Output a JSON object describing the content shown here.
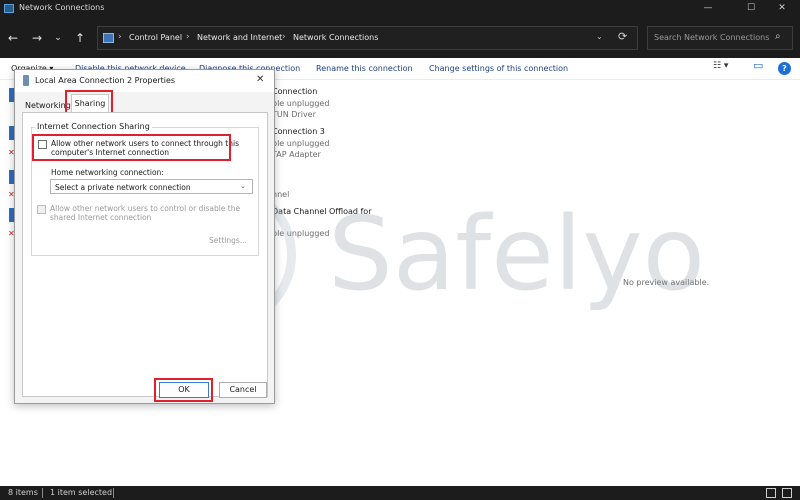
{
  "window": {
    "title": "Network Connections",
    "controls": {
      "minimize": "—",
      "maximize": "☐",
      "close": "✕"
    }
  },
  "nav": {
    "back": "←",
    "forward": "→",
    "recent": "⌄",
    "up": "↑",
    "breadcrumbs": [
      "Control Panel",
      "Network and Internet",
      "Network Connections"
    ],
    "separator": "›",
    "dropdown": "⌄",
    "refresh": "⟳",
    "search_placeholder": "Search Network Connections",
    "search_icon": "⌕"
  },
  "commands": {
    "organize": "Organize ▾",
    "disable": "Disable this network device",
    "diagnose": "Diagnose this connection",
    "rename": "Rename this connection",
    "change": "Change settings of this connection",
    "view_toggle": "☷ ▾",
    "preview_pane": "▭",
    "help": "?"
  },
  "list": {
    "items": [
      {
        "name": "Connection",
        "line2": "ble unplugged",
        "line3": "TUN Driver"
      },
      {
        "name": "Connection 3",
        "line2": "ble unplugged",
        "line3": "TAP Adapter"
      },
      {
        "name": "",
        "line2": "nnel",
        "line3": ""
      },
      {
        "name": "Data Channel Offload for",
        "line2": "",
        "line3": "ble unplugged"
      }
    ],
    "no_preview": "No preview available."
  },
  "watermark": {
    "text": "Safelyo"
  },
  "dialog": {
    "title": "Local Area Connection 2 Properties",
    "close": "✕",
    "tabs": {
      "networking": "Networking",
      "sharing": "Sharing"
    },
    "group_label": "Internet Connection Sharing",
    "allow_other_users": {
      "line1": "Allow other network users to connect through this",
      "line2": "computer's Internet connection",
      "checked": false
    },
    "home_networking_label": "Home networking connection:",
    "home_networking_value": "Select a private network connection",
    "select_arrow": "⌄",
    "allow_control": {
      "line1": "Allow other network users to control or disable the",
      "line2": "shared Internet connection",
      "checked": false
    },
    "settings_button": "Settings...",
    "ok_button": "OK",
    "cancel_button": "Cancel",
    "highlight_color": "#e0202a"
  },
  "status": {
    "items_count": "8 items",
    "selected": "1 item selected"
  }
}
